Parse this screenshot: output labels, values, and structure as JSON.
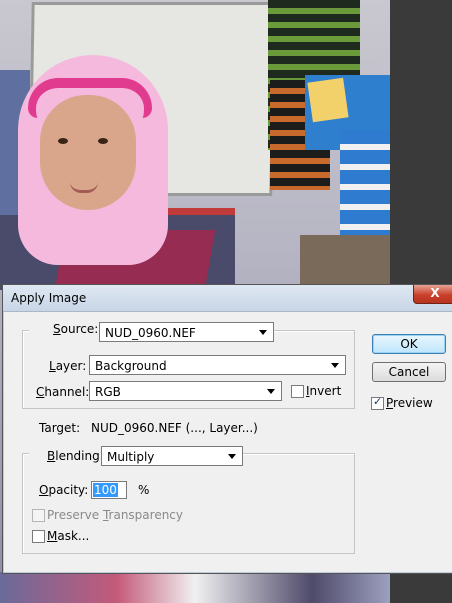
{
  "dialog": {
    "title": "Apply Image",
    "close_label": "X",
    "source": {
      "label_pre": "",
      "label_u": "S",
      "label_post": "ource:",
      "value": "NUD_0960.NEF"
    },
    "layer": {
      "label_u": "L",
      "label_post": "ayer:",
      "value": "Background"
    },
    "channel": {
      "label_u": "C",
      "label_post": "hannel:",
      "value": "RGB"
    },
    "invert": {
      "label_u": "I",
      "label_post": "nvert",
      "checked": false
    },
    "target": {
      "label": "Target:",
      "value": "NUD_0960.NEF (..., Layer...)"
    },
    "blending": {
      "label_u": "B",
      "label_post": "lending:",
      "value": "Multiply"
    },
    "opacity": {
      "label_u": "O",
      "label_post": "pacity:",
      "value": "100",
      "unit": "%"
    },
    "preserve_transparency": {
      "label_pre": "Preserve ",
      "label_u": "T",
      "label_post": "ransparency",
      "checked": false,
      "enabled": false
    },
    "mask": {
      "label_u": "M",
      "label_post": "ask...",
      "checked": false
    },
    "buttons": {
      "ok": "OK",
      "cancel": "Cancel"
    },
    "preview": {
      "label_u": "P",
      "label_post": "review",
      "checked": true
    }
  }
}
